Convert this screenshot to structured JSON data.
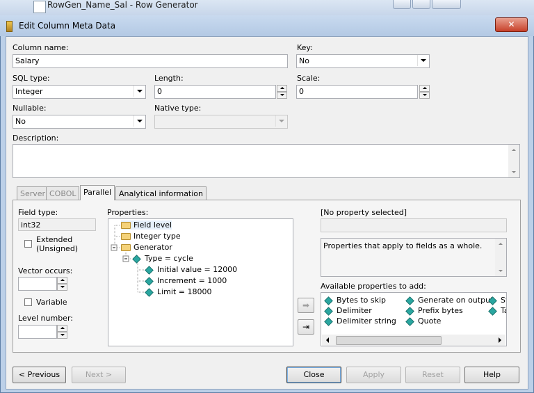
{
  "background_window": {
    "title": "RowGen_Name_Sal - Row Generator"
  },
  "dialog": {
    "title": "Edit Column Meta Data",
    "close_glyph": "✕"
  },
  "fields": {
    "column_name": {
      "label": "Column name:",
      "value": "Salary"
    },
    "key": {
      "label": "Key:",
      "value": "No"
    },
    "sql_type": {
      "label": "SQL type:",
      "value": "Integer"
    },
    "length": {
      "label": "Length:",
      "value": "0"
    },
    "scale": {
      "label": "Scale:",
      "value": "0"
    },
    "nullable": {
      "label": "Nullable:",
      "value": "No"
    },
    "native_type": {
      "label": "Native type:",
      "value": ""
    },
    "description": {
      "label": "Description:",
      "value": ""
    }
  },
  "tabs": [
    {
      "label": "Server",
      "state": "disabled"
    },
    {
      "label": "COBOL",
      "state": "disabled"
    },
    {
      "label": "Parallel",
      "state": "active"
    },
    {
      "label": "Analytical information",
      "state": "normal"
    }
  ],
  "parallel": {
    "field_type_label": "Field type:",
    "field_type_value": "int32",
    "extended_label_1": "Extended",
    "extended_label_2": "(Unsigned)",
    "vector_occurs_label": "Vector occurs:",
    "variable_label": "Variable",
    "level_number_label": "Level number:",
    "properties_label": "Properties:",
    "tree": [
      {
        "label": "Field level",
        "icon": "folder",
        "level": 0
      },
      {
        "label": "Integer type",
        "icon": "folder",
        "level": 0
      },
      {
        "label": "Generator",
        "icon": "folder",
        "level": 0
      },
      {
        "label": "Type = cycle",
        "icon": "property",
        "level": 1
      },
      {
        "label": "Initial value = 12000",
        "icon": "property",
        "level": 2
      },
      {
        "label": "Increment = 1000",
        "icon": "property",
        "level": 2
      },
      {
        "label": "Limit = 18000",
        "icon": "property",
        "level": 2
      }
    ],
    "selected_property_label": "[No property selected]",
    "property_help": "Properties that apply to fields as a whole.",
    "available_label": "Available properties to add:",
    "available": [
      [
        "Bytes to skip",
        "Delimiter",
        "Delimiter string"
      ],
      [
        "Generate on output",
        "Prefix bytes",
        "Quote"
      ],
      [
        "St",
        "Ta"
      ]
    ]
  },
  "buttons": {
    "previous": "< Previous",
    "next": "Next >",
    "close": "Close",
    "apply": "Apply",
    "reset": "Reset",
    "help": "Help"
  }
}
